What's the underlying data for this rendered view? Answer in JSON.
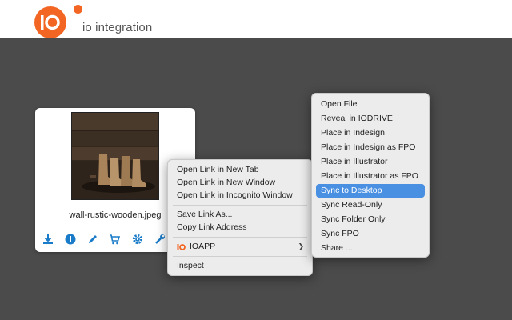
{
  "header": {
    "brand": "io integration",
    "logo_text": "io"
  },
  "colors": {
    "brand_orange": "#f26522",
    "accent_blue": "#1a7bc8",
    "selection": "#4a90e2"
  },
  "asset": {
    "filename": "wall-rustic-wooden.jpeg",
    "actions": [
      "download-icon",
      "info-icon",
      "pencil-icon",
      "cart-icon",
      "gear-icon",
      "wrench-icon"
    ]
  },
  "browser_menu": {
    "items": [
      "Open Link in New Tab",
      "Open Link in New Window",
      "Open Link in Incognito Window"
    ],
    "items2": [
      "Save Link As...",
      "Copy Link Address"
    ],
    "ioapp": "IOAPP",
    "inspect": "Inspect"
  },
  "submenu": {
    "items": [
      "Open File",
      "Reveal in IODRIVE",
      "Place in Indesign",
      "Place in Indesign as FPO",
      "Place in Illustrator",
      "Place in Illustrator as FPO",
      "Sync to Desktop",
      "Sync Read-Only",
      "Sync Folder Only",
      "Sync FPO",
      "Share ..."
    ],
    "selected": "Sync to Desktop"
  }
}
